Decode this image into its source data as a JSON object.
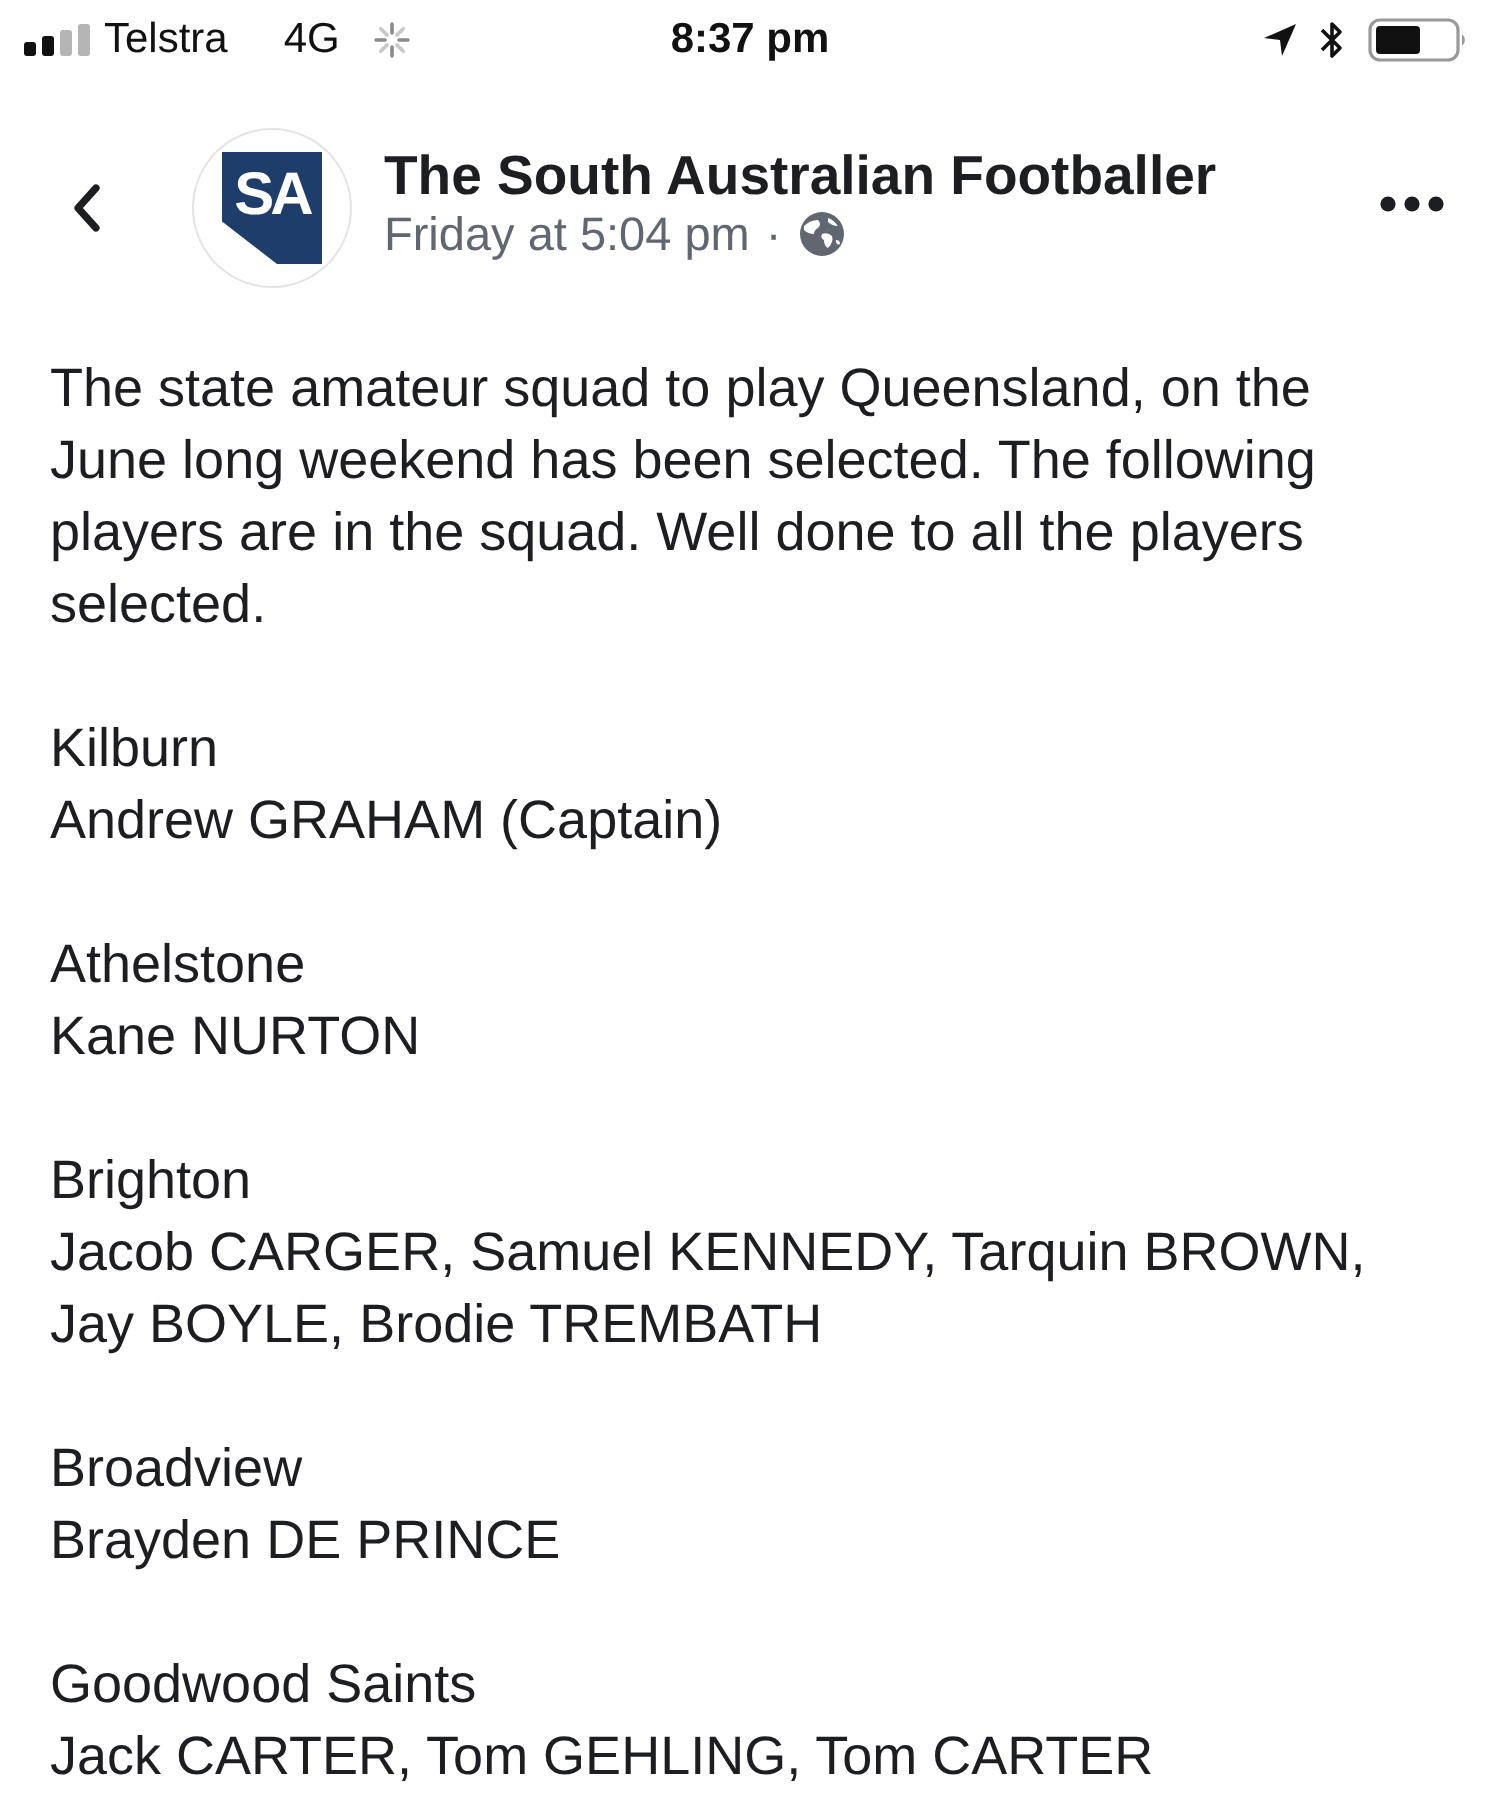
{
  "status_bar": {
    "carrier": "Telstra",
    "network": "4G",
    "time": "8:37 pm"
  },
  "header": {
    "page_name": "The South Australian Footballer",
    "logo_text": "SA",
    "timestamp": "Friday at 5:04 pm",
    "separator": "·"
  },
  "post": {
    "body": "The state amateur squad to play Queensland, on the June long weekend has been selected. The following players are in the squad. Well done to all the players selected.",
    "groups": [
      {
        "club": "Kilburn",
        "players": "Andrew GRAHAM (Captain)"
      },
      {
        "club": "Athelstone",
        "players": "Kane NURTON"
      },
      {
        "club": "Brighton",
        "players": "Jacob CARGER, Samuel KENNEDY, Tarquin BROWN, Jay BOYLE, Brodie TREMBATH"
      },
      {
        "club": "Broadview",
        "players": "Brayden DE PRINCE"
      },
      {
        "club": "Goodwood Saints",
        "players": "Jack CARTER, Tom GEHLING, Tom CARTER"
      }
    ]
  }
}
